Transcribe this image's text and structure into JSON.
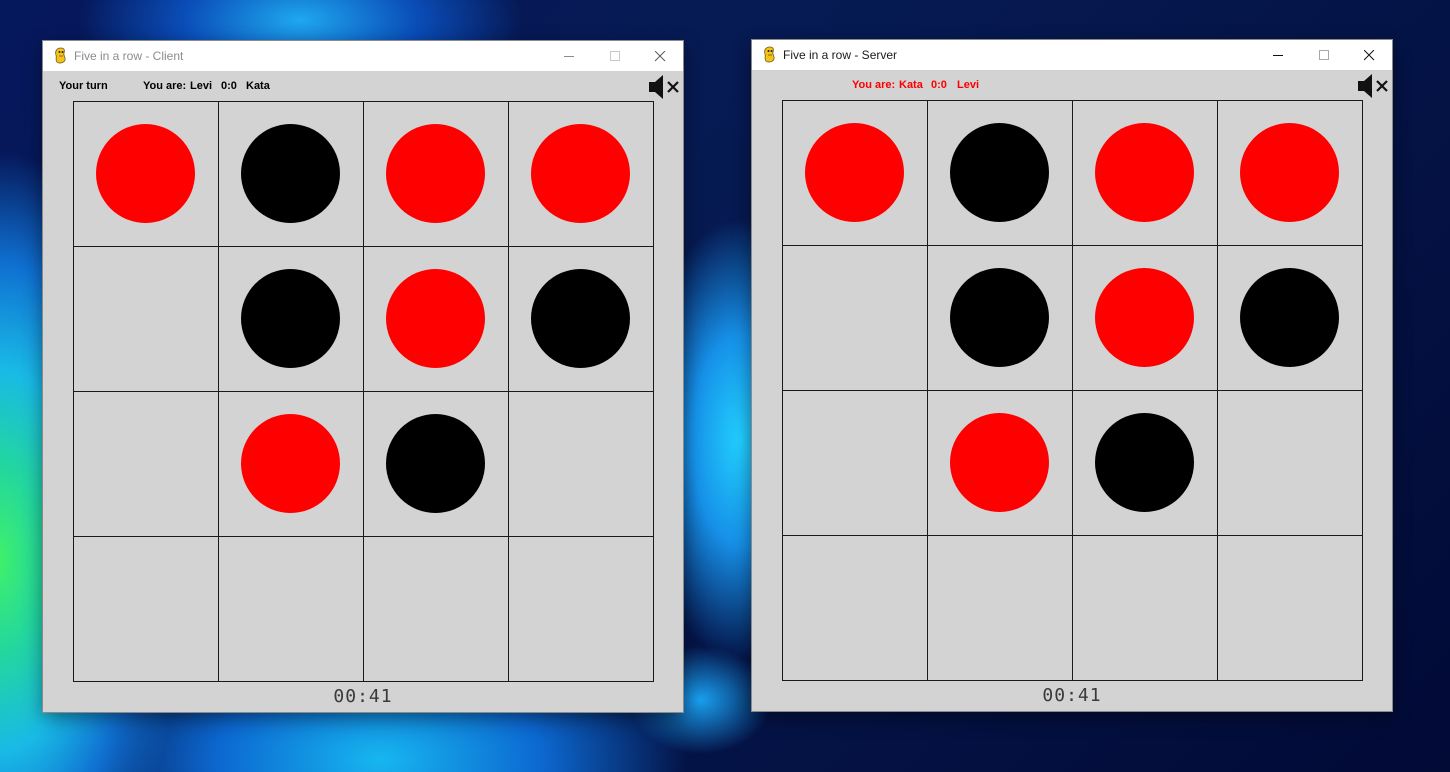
{
  "colors": {
    "red_piece": "#ff0000",
    "black_piece": "#000000",
    "board_bg": "#d3d3d3",
    "grid_line": "#1a1a1a",
    "server_status_text": "#ff0000"
  },
  "icons": {
    "app": "pygame-snake-icon",
    "sound": "speaker-muted-icon",
    "minimize": "minimize-icon",
    "maximize": "maximize-icon",
    "close": "close-icon"
  },
  "windows": [
    {
      "id": "client",
      "title": "Five in a row - Client",
      "title_state": "inactive",
      "turn_text": "Your turn",
      "you_are_label": "You are:",
      "player_self": "Levi",
      "score": "0:0",
      "player_opponent": "Kata",
      "timer": "00:41",
      "board": [
        [
          "red",
          "black",
          "red",
          "red"
        ],
        [
          "",
          "black",
          "red",
          "black"
        ],
        [
          "",
          "red",
          "black",
          ""
        ],
        [
          "",
          "",
          "",
          ""
        ]
      ]
    },
    {
      "id": "server",
      "title": "Five in a row - Server",
      "title_state": "active",
      "turn_text": "",
      "you_are_label": "You are:",
      "player_self": "Kata",
      "score": "0:0",
      "player_opponent": "Levi",
      "timer": "00:41",
      "board": [
        [
          "red",
          "black",
          "red",
          "red"
        ],
        [
          "",
          "black",
          "red",
          "black"
        ],
        [
          "",
          "red",
          "black",
          ""
        ],
        [
          "",
          "",
          "",
          ""
        ]
      ]
    }
  ]
}
